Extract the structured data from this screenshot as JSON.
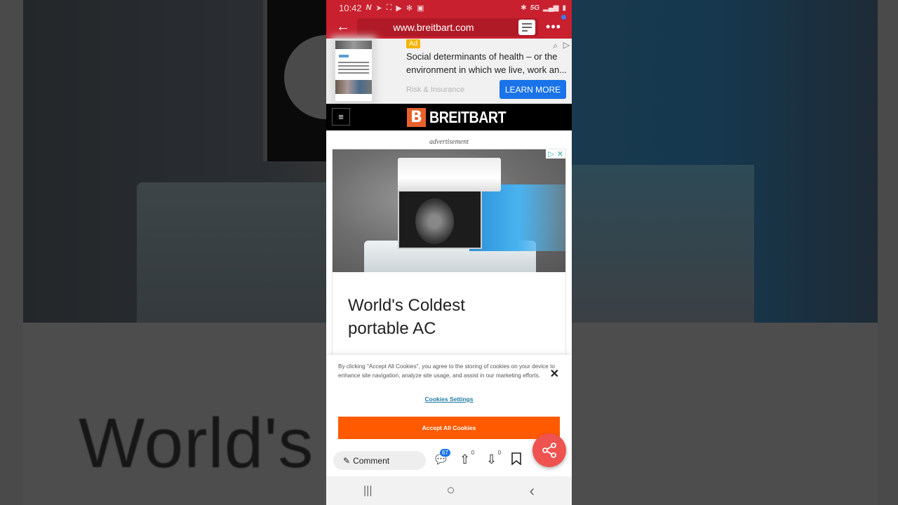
{
  "status_bar": {
    "time": "10:42",
    "left_icons": [
      "netflix-icon",
      "send-icon",
      "screenshot-frame-icon",
      "youtube-icon",
      "pinwheel-icon",
      "cast-icon"
    ],
    "network": "5G",
    "right_icons": [
      "bluetooth-icon",
      "signal-icon",
      "battery-icon"
    ]
  },
  "browser": {
    "url": "www.breitbart.com",
    "back_icon": "←",
    "more_icon": "•••",
    "accent_color": "#c8202e"
  },
  "top_ad": {
    "badge": "Ad",
    "title": "Social determinants of health – or the environment in which we live, work an...",
    "source": "Risk & Insurance",
    "cta": "LEARN MORE"
  },
  "site_header": {
    "menu_icon": "≡",
    "logo_letter": "B",
    "logo_text": "BREITBART",
    "brand_color": "#e8612c"
  },
  "advertisement_label": "advertisement",
  "main_ad": {
    "headline_line1": "World's Coldest",
    "headline_line2": "portable AC",
    "adchoices_icon": "▷",
    "close_icon": "✕"
  },
  "background_mirror_text": "World's C",
  "cookie_banner": {
    "text": "By clicking \"Accept All Cookies\", you agree to the storing of cookies on your device to enhance site navigation, analyze site usage, and assist in our marketing efforts.",
    "close_icon": "✕",
    "settings_label": "Cookies Settings",
    "accept_label": "Accept All Cookies",
    "accept_color": "#ff5a00"
  },
  "bottom_bar": {
    "comment_label": "Comment",
    "comment_count": "67",
    "upvotes": "0",
    "downvotes": "0"
  },
  "nav_bar": {
    "recents_icon": "|||",
    "home_icon": "○",
    "back_icon": "‹"
  }
}
